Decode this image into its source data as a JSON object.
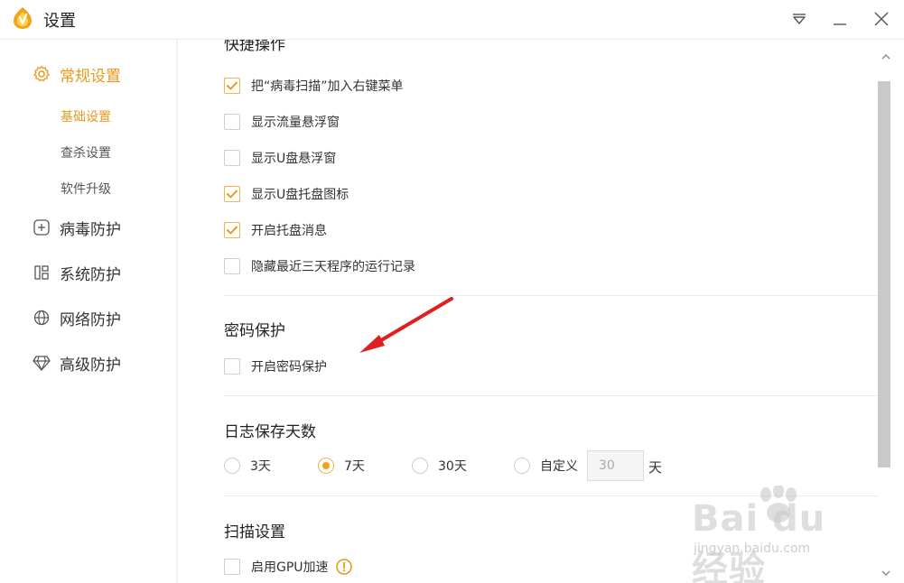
{
  "window": {
    "title": "设置",
    "controls": [
      "dropdown-icon",
      "minimize-icon",
      "close-icon"
    ]
  },
  "sidebar": {
    "sections": [
      {
        "label": "常规设置",
        "icon": "gear-icon",
        "active": true,
        "items": [
          {
            "label": "基础设置",
            "active": true
          },
          {
            "label": "查杀设置",
            "active": false
          },
          {
            "label": "软件升级",
            "active": false
          }
        ]
      },
      {
        "label": "病毒防护",
        "icon": "plus-square-icon",
        "active": false
      },
      {
        "label": "系统防护",
        "icon": "windows-grid-icon",
        "active": false
      },
      {
        "label": "网络防护",
        "icon": "globe-icon",
        "active": false
      },
      {
        "label": "高级防护",
        "icon": "diamond-icon",
        "active": false
      }
    ]
  },
  "content": {
    "shortcut_section": {
      "title": "快捷操作",
      "options": [
        {
          "label": "把“病毒扫描”加入右键菜单",
          "checked": true
        },
        {
          "label": "显示流量悬浮窗",
          "checked": false
        },
        {
          "label": "显示U盘悬浮窗",
          "checked": false
        },
        {
          "label": "显示U盘托盘图标",
          "checked": true
        },
        {
          "label": "开启托盘消息",
          "checked": true
        },
        {
          "label": "隐藏最近三天程序的运行记录",
          "checked": false
        }
      ]
    },
    "password_section": {
      "title": "密码保护",
      "option": {
        "label": "开启密码保护",
        "checked": false
      }
    },
    "log_section": {
      "title": "日志保存天数",
      "options": [
        {
          "label": "3天",
          "selected": false
        },
        {
          "label": "7天",
          "selected": true
        },
        {
          "label": "30天",
          "selected": false
        },
        {
          "label": "自定义",
          "selected": false
        }
      ],
      "custom_value": "30",
      "unit": "天"
    },
    "scan_section": {
      "title": "扫描设置",
      "option": {
        "label": "启用GPU加速",
        "checked": false
      }
    }
  },
  "colors": {
    "accent": "#e8991c",
    "check_border": "#f0b24a",
    "arrow": "#e02020",
    "scroll_thumb": "#c9c9c9"
  },
  "watermark": {
    "brand": "Bai du 经验",
    "url": "jingyan.baidu.com"
  }
}
